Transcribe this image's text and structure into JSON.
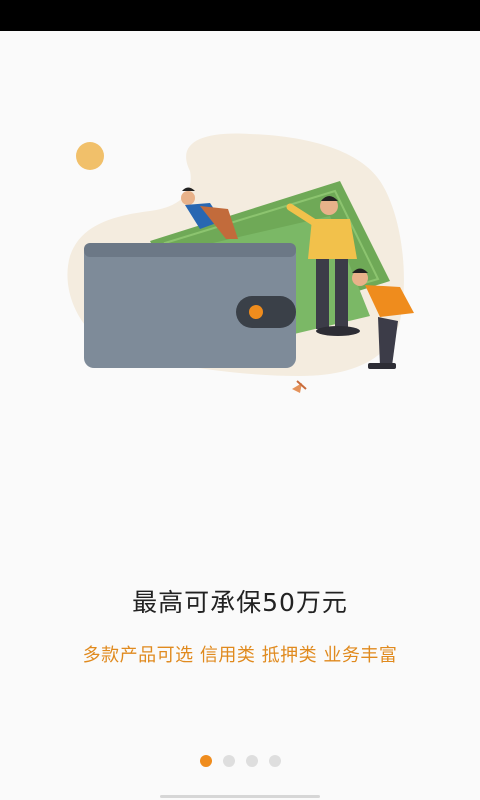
{
  "onboarding": {
    "headline": "最高可承保50万元",
    "subline": "多款产品可选 信用类 抵押类 业务丰富",
    "page_count": 4,
    "current_page": 1
  },
  "colors": {
    "accent": "#ef8c1d",
    "headline": "#222222",
    "subline": "#e08a1e",
    "dot_inactive": "#dedede"
  },
  "illustration": {
    "subject": "wallet with money bills and three people"
  }
}
